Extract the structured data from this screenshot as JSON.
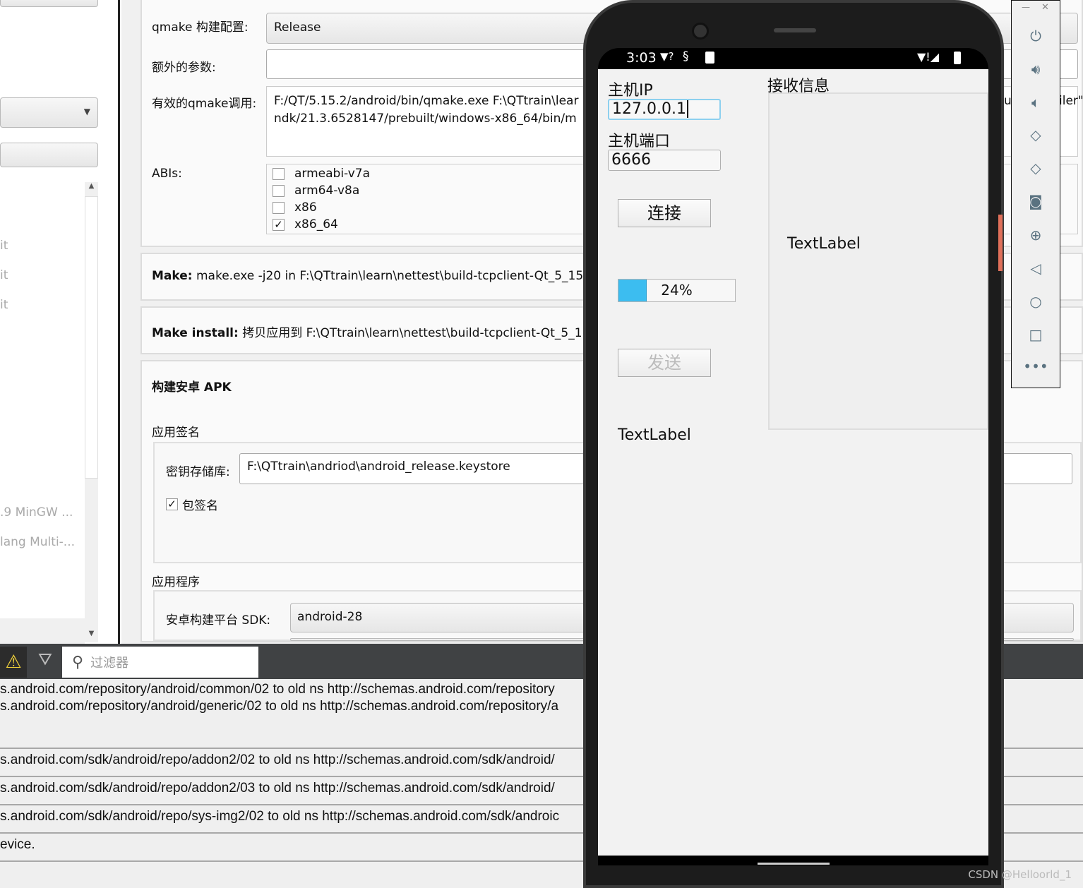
{
  "left_panel": {
    "items": [
      "it",
      "it",
      "it"
    ],
    "kits": [
      ".9 MinGW ...",
      "lang Multi-..."
    ]
  },
  "qmake": {
    "config_label": "qmake 构建配置:",
    "config_value": "Release",
    "extra_label": "额外的参数:",
    "extra_value": "",
    "call_label": "有效的qmake调用:",
    "call_line1": "F:/QT/5.15.2/android/bin/qmake.exe F:\\QTtrain\\lear",
    "call_line2": "ndk/21.3.6528147/prebuilt/windows-x86_64/bin/m",
    "abis_label": "ABIs:",
    "abis": [
      {
        "name": "armeabi-v7a",
        "checked": false
      },
      {
        "name": "arm64-v8a",
        "checked": false
      },
      {
        "name": "x86",
        "checked": false
      },
      {
        "name": "x86_64",
        "checked": true
      }
    ]
  },
  "make": {
    "label": "Make:",
    "value": "make.exe -j20 in F:\\QTtrain\\learn\\nettest\\build-tcpclient-Qt_5_15"
  },
  "make_install": {
    "label": "Make install:",
    "value": "拷贝应用到 F:\\QTtrain\\learn\\nettest\\build-tcpclient-Qt_5_1"
  },
  "apk": {
    "title": "构建安卓 APK",
    "signing_label": "应用签名",
    "keystore_label": "密钥存储库:",
    "keystore_value": "F:\\QTtrain\\andriod\\android_release.keystore",
    "sign_pkg_label": "包签名",
    "sign_pkg_checked": true,
    "app_label": "应用程序",
    "sdk_label": "安卓构建平台 SDK:",
    "sdk_value": "android-28"
  },
  "right_fragment": {
    "text1": "u",
    "text2": "iler\""
  },
  "output": {
    "filter_placeholder": "过滤器",
    "lines": [
      "s.android.com/repository/android/common/02 to old ns http://schemas.android.com/repository",
      "s.android.com/repository/android/generic/02 to old ns http://schemas.android.com/repository/a",
      "s.android.com/sdk/android/repo/addon2/02 to old ns http://schemas.android.com/sdk/android/",
      "s.android.com/sdk/android/repo/addon2/03 to old ns http://schemas.android.com/sdk/android/",
      "s.android.com/sdk/android/repo/sys-img2/02 to old ns http://schemas.android.com/sdk/androic",
      "evice."
    ]
  },
  "phone": {
    "time": "3:03",
    "ip_label": "主机IP",
    "ip_value": "127.0.0.1",
    "port_label": "主机端口",
    "port_value": "6666",
    "connect": "连接",
    "progress_percent": 24,
    "progress_text": "24%",
    "send": "发送",
    "text_label_left": "TextLabel",
    "recv_label": "接收信息",
    "text_label_right": "TextLabel",
    "accent": "#3cbdf0"
  },
  "watermark": "CSDN @Helloorld_1"
}
